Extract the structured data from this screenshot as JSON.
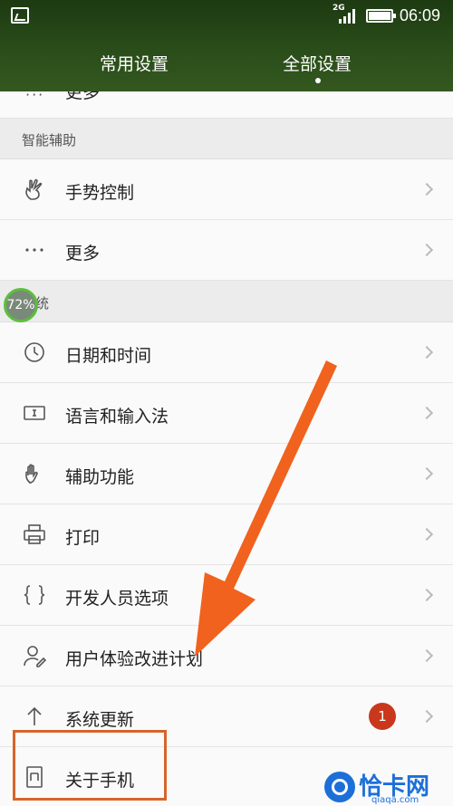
{
  "status_bar": {
    "network": "2G",
    "time": "06:09"
  },
  "tabs": [
    {
      "label": "常用设置",
      "active": false
    },
    {
      "label": "全部设置",
      "active": true
    }
  ],
  "clipped_item": {
    "label": "更多"
  },
  "sections": [
    {
      "title": "智能辅助"
    },
    {
      "title": "系统"
    }
  ],
  "smart_assist_items": [
    {
      "label": "手势控制",
      "icon": "gesture-hand-icon"
    },
    {
      "label": "更多",
      "icon": "more-dots-icon"
    }
  ],
  "system_items": [
    {
      "label": "日期和时间",
      "icon": "clock-icon"
    },
    {
      "label": "语言和输入法",
      "icon": "keyboard-icon"
    },
    {
      "label": "辅助功能",
      "icon": "hand-icon"
    },
    {
      "label": "打印",
      "icon": "printer-icon"
    },
    {
      "label": "开发人员选项",
      "icon": "braces-icon"
    },
    {
      "label": "用户体验改进计划",
      "icon": "user-icon"
    },
    {
      "label": "系统更新",
      "icon": "arrow-up-icon",
      "badge": "1"
    },
    {
      "label": "关于手机",
      "icon": "phone-icon"
    }
  ],
  "overlay": {
    "percent": "72%"
  },
  "watermark": {
    "text": "恰卡网",
    "sub": "qiaqa.com"
  },
  "colors": {
    "header": "#2a4d1a",
    "arrow": "#f0621e",
    "badge": "#c9381c",
    "highlight": "#d8632a"
  }
}
